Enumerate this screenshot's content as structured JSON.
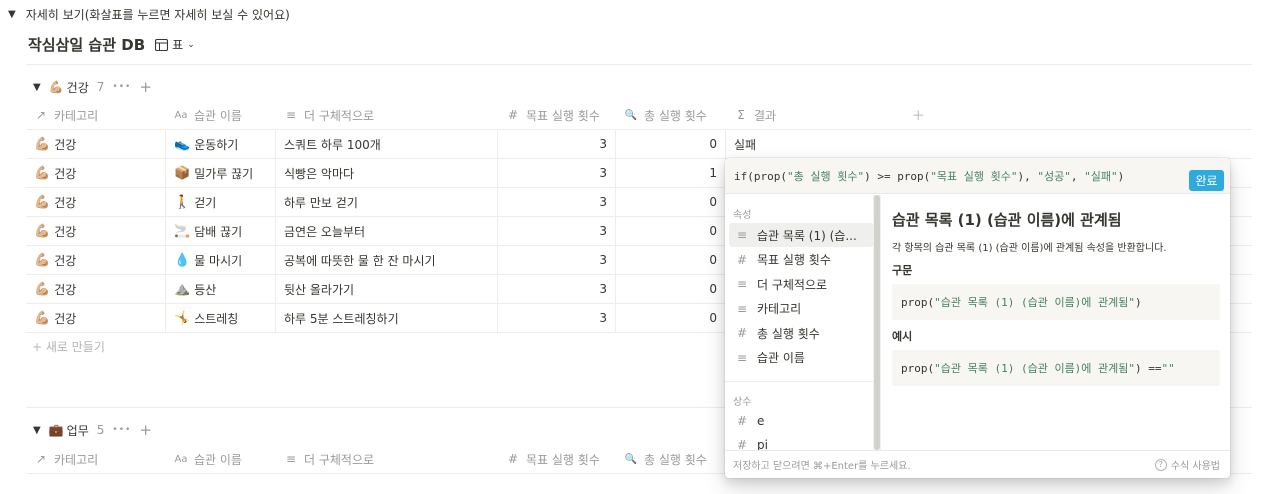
{
  "top_toggle": {
    "arrow": "▼",
    "label": "자세히 보기(화살표를 누르면 자세히 보실 수 있어요)"
  },
  "db": {
    "title": "작심삼일 습관 DB",
    "view_icon": "table-icon",
    "view_label": "표"
  },
  "groups": [
    {
      "arrow": "▼",
      "emoji": "💪🏼",
      "name": "건강",
      "count": "7",
      "more": "•••",
      "add": "+"
    },
    {
      "arrow": "▼",
      "emoji": "💼",
      "name": "업무",
      "count": "5",
      "more": "•••",
      "add": "+"
    }
  ],
  "columns": [
    {
      "icon": "↗",
      "icon_name": "relation-icon",
      "label": "카테고리"
    },
    {
      "icon": "Aa",
      "icon_name": "title-icon",
      "label": "습관 이름"
    },
    {
      "icon": "≡",
      "icon_name": "text-icon",
      "label": "더 구체적으로"
    },
    {
      "icon": "#",
      "icon_name": "number-icon",
      "label": "목표 실행 횟수"
    },
    {
      "icon": "🔍",
      "icon_name": "rollup-icon",
      "label": "총 실행 횟수"
    },
    {
      "icon": "Σ",
      "icon_name": "formula-icon",
      "label": "결과"
    }
  ],
  "add_column": "+",
  "rows": [
    {
      "cat_emoji": "💪🏼",
      "category": "건강",
      "habit_emoji": "👟",
      "habit": "운동하기",
      "detail": "스쿼트 하루 100개",
      "goal": "3",
      "total": "0",
      "result": "실패"
    },
    {
      "cat_emoji": "💪🏼",
      "category": "건강",
      "habit_emoji": "📦",
      "habit": "밀가루 끊기",
      "detail": "식빵은 악마다",
      "goal": "3",
      "total": "1",
      "result": ""
    },
    {
      "cat_emoji": "💪🏼",
      "category": "건강",
      "habit_emoji": "🚶",
      "habit": "걷기",
      "detail": "하루 만보 걷기",
      "goal": "3",
      "total": "0",
      "result": ""
    },
    {
      "cat_emoji": "💪🏼",
      "category": "건강",
      "habit_emoji": "🚬",
      "habit": "담배 끊기",
      "detail": "금연은 오늘부터",
      "goal": "3",
      "total": "0",
      "result": ""
    },
    {
      "cat_emoji": "💪🏼",
      "category": "건강",
      "habit_emoji": "💧",
      "habit": "물 마시기",
      "detail": "공복에 따뜻한 물 한 잔 마시기",
      "goal": "3",
      "total": "0",
      "result": ""
    },
    {
      "cat_emoji": "💪🏼",
      "category": "건강",
      "habit_emoji": "⛰️",
      "habit": "등산",
      "detail": "뒷산 올라가기",
      "goal": "3",
      "total": "0",
      "result": ""
    },
    {
      "cat_emoji": "💪🏼",
      "category": "건강",
      "habit_emoji": "🤸",
      "habit": "스트레칭",
      "detail": "하루 5분 스트레칭하기",
      "goal": "3",
      "total": "0",
      "result": ""
    }
  ],
  "new_row": "+ 새로 만들기",
  "popup": {
    "formula": {
      "p1": "if(prop(",
      "s1": "\"총 실행 횟수\"",
      "p2": ") >= prop(",
      "s2": "\"목표 실행 횟수\"",
      "p3": "), ",
      "s3": "\"성공\"",
      "p4": ", ",
      "s4": "\"실패\"",
      "p5": ")"
    },
    "done_label": "완료",
    "section_props": "속성",
    "props": [
      {
        "icon": "≡",
        "icon_name": "text-icon",
        "label": "습관 목록 (1) (습..."
      },
      {
        "icon": "#",
        "icon_name": "number-icon",
        "label": "목표 실행 횟수"
      },
      {
        "icon": "≡",
        "icon_name": "text-icon",
        "label": "더 구체적으로"
      },
      {
        "icon": "≡",
        "icon_name": "text-icon",
        "label": "카테고리"
      },
      {
        "icon": "#",
        "icon_name": "number-icon",
        "label": "총 실행 횟수"
      },
      {
        "icon": "≡",
        "icon_name": "text-icon",
        "label": "습관 이름"
      }
    ],
    "section_consts": "상수",
    "consts": [
      {
        "icon": "#",
        "icon_name": "number-icon",
        "label": "e"
      },
      {
        "icon": "#",
        "icon_name": "number-icon",
        "label": "pi"
      }
    ],
    "detail_title": "습관 목록 (1) (습관 이름)에 관계됨",
    "detail_desc": "각 항목의 습관 목록 (1) (습관 이름)에 관계됨 속성을 반환합니다.",
    "syntax_label": "구문",
    "syntax_code": {
      "p1": "prop(",
      "s1": "\"습관 목록 (1) (습관 이름)에 관계됨\"",
      "p2": ")"
    },
    "example_label": "예시",
    "example_code": {
      "p1": "prop(",
      "s1": "\"습관 목록 (1) (습관 이름)에 관계됨\"",
      "p2": ") == ",
      "s2": "\"\""
    },
    "footer_hint": "저장하고 닫으려면 ⌘+Enter를 누르세요.",
    "footer_help": "수식 사용법",
    "footer_help_icon": "?"
  },
  "colors": {
    "accent": "#2eaadc",
    "string": "#448361",
    "muted": "#9b9a97",
    "text": "#37352f"
  }
}
